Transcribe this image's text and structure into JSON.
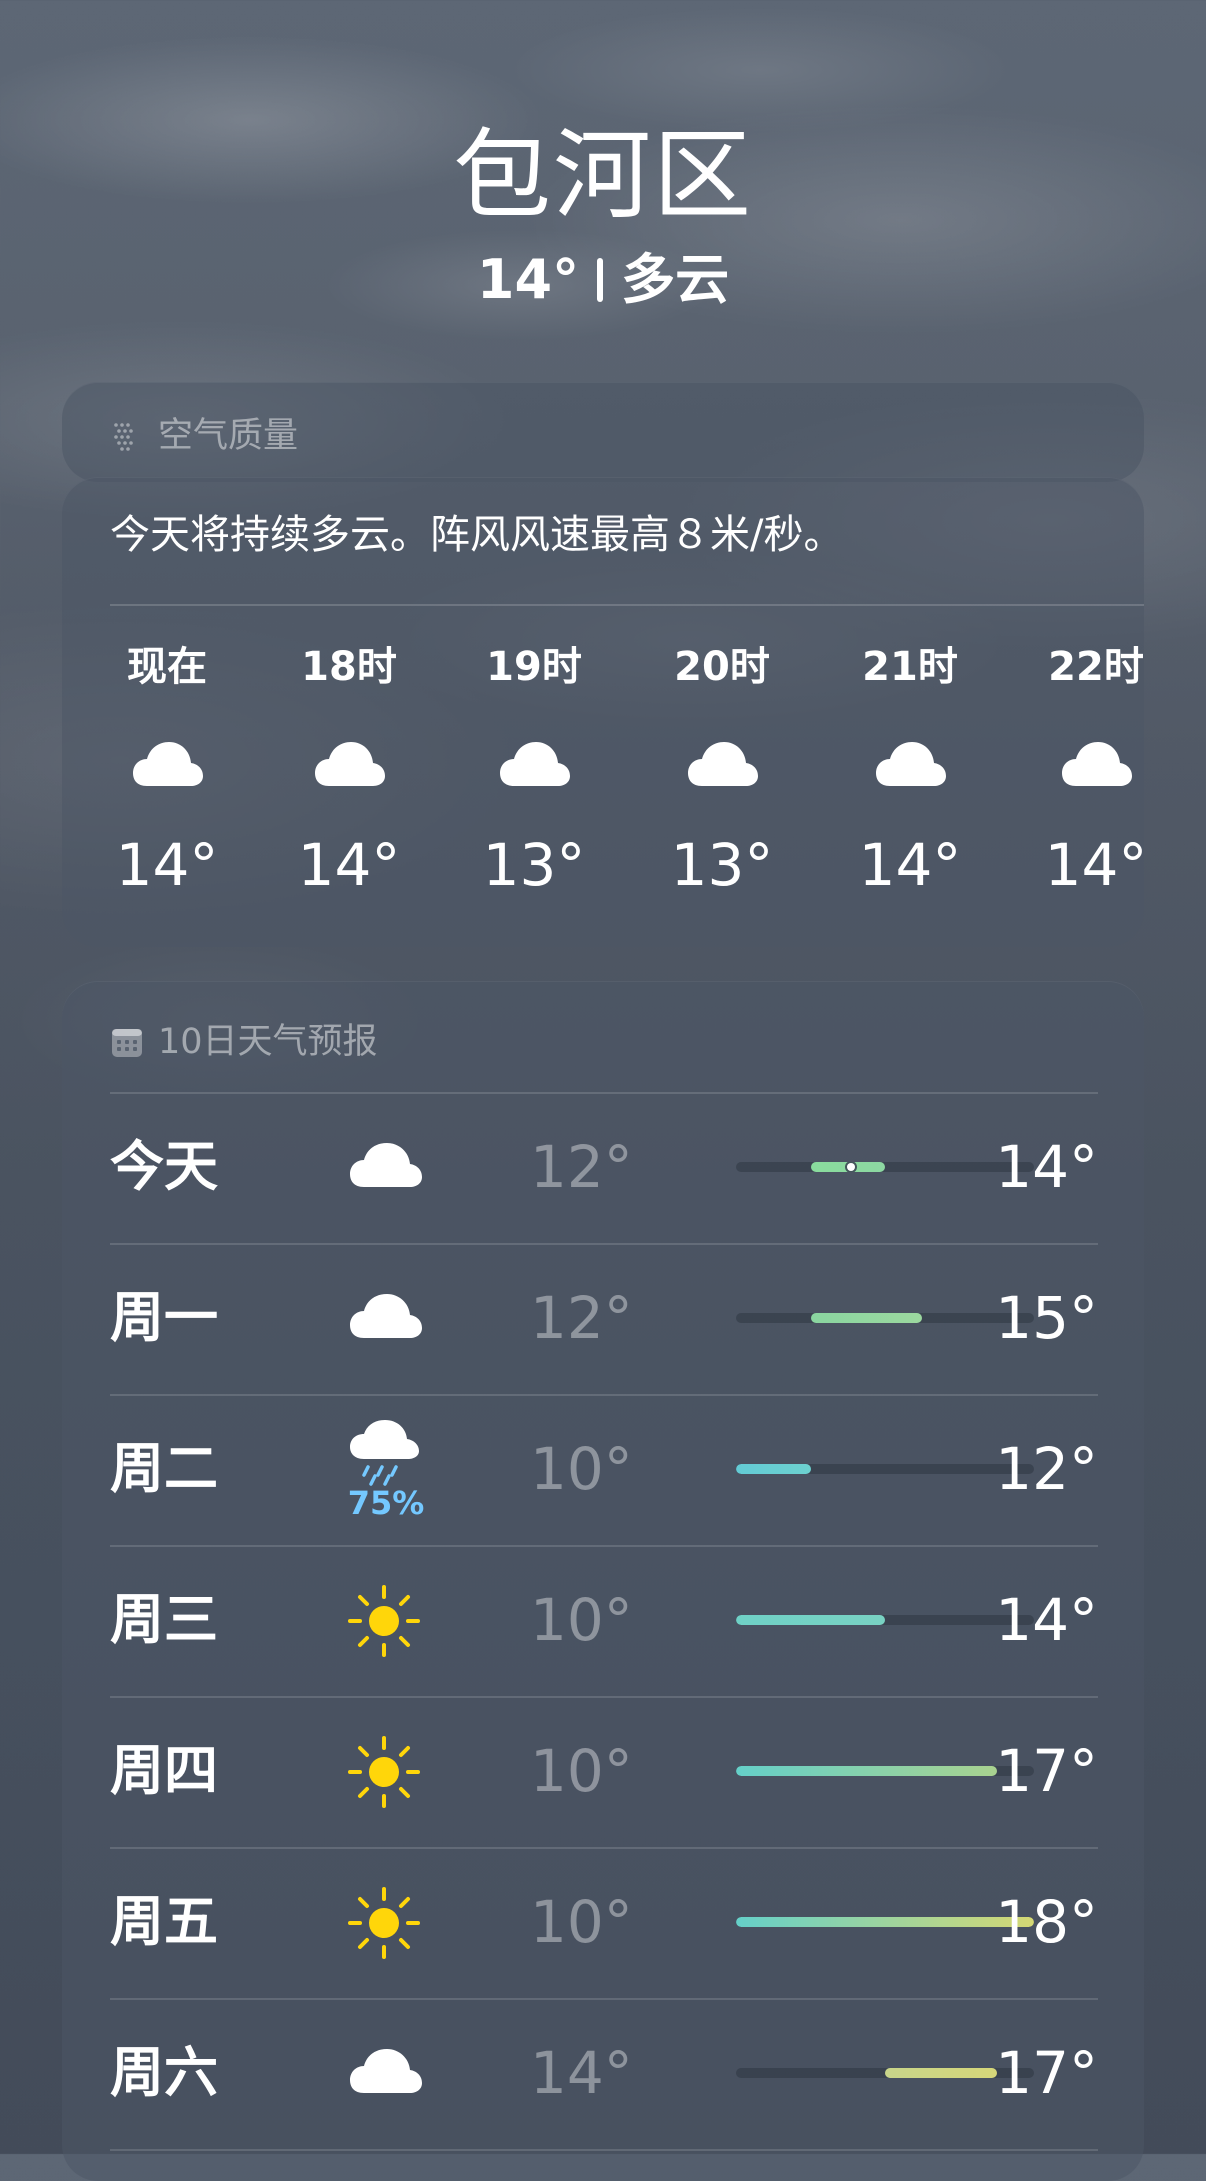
{
  "header": {
    "city": "包河区",
    "current_temp": "14°",
    "condition": "多云"
  },
  "air_quality": {
    "label": "空气质量",
    "icon": "air-quality-icon"
  },
  "hourly": {
    "summary": "今天将持续多云。阵风风速最高８米/秒。",
    "items": [
      {
        "time": "现在",
        "icon": "cloud-icon",
        "temp": "14°"
      },
      {
        "time": "18时",
        "icon": "cloud-icon",
        "temp": "14°"
      },
      {
        "time": "19时",
        "icon": "cloud-icon",
        "temp": "13°"
      },
      {
        "time": "20时",
        "icon": "cloud-icon",
        "temp": "13°"
      },
      {
        "time": "21时",
        "icon": "cloud-icon",
        "temp": "14°"
      },
      {
        "time": "22时",
        "icon": "cloud-icon",
        "temp": "14°"
      }
    ]
  },
  "daily": {
    "title": "10日天气预报",
    "icon": "calendar-icon",
    "range_scale": {
      "min": 10,
      "max": 18
    },
    "days": [
      {
        "day": "今天",
        "icon": "cloud-icon",
        "low": "12°",
        "high": "14°",
        "low_value": 12,
        "high_value": 14,
        "current_value": 13.1,
        "color_start": "#89dc9d",
        "color_end": "#8dd8a2"
      },
      {
        "day": "周一",
        "icon": "cloud-icon",
        "low": "12°",
        "high": "15°",
        "low_value": 12,
        "high_value": 15,
        "color_start": "#8ad6a0",
        "color_end": "#9cd89f"
      },
      {
        "day": "周二",
        "icon": "rain-cloud-icon",
        "precipitation": "75%",
        "low": "10°",
        "high": "12°",
        "low_value": 10,
        "high_value": 12,
        "color_start": "#63cbd5",
        "color_end": "#6dd1cf"
      },
      {
        "day": "周三",
        "icon": "sun-icon",
        "low": "10°",
        "high": "14°",
        "low_value": 10,
        "high_value": 14,
        "color_start": "#6fd1c6",
        "color_end": "#79d2c3"
      },
      {
        "day": "周四",
        "icon": "sun-icon",
        "low": "10°",
        "high": "17°",
        "low_value": 10,
        "high_value": 17,
        "color_start": "#65d0c9",
        "color_end": "#a9d28f"
      },
      {
        "day": "周五",
        "icon": "sun-icon",
        "low": "10°",
        "high": "18°",
        "low_value": 10,
        "high_value": 18,
        "color_start": "#65d0c9",
        "color_end": "#d5d874"
      },
      {
        "day": "周六",
        "icon": "cloud-icon",
        "low": "14°",
        "high": "17°",
        "low_value": 14,
        "high_value": 17,
        "color_start": "#c8d58a",
        "color_end": "#d6d779"
      }
    ]
  }
}
